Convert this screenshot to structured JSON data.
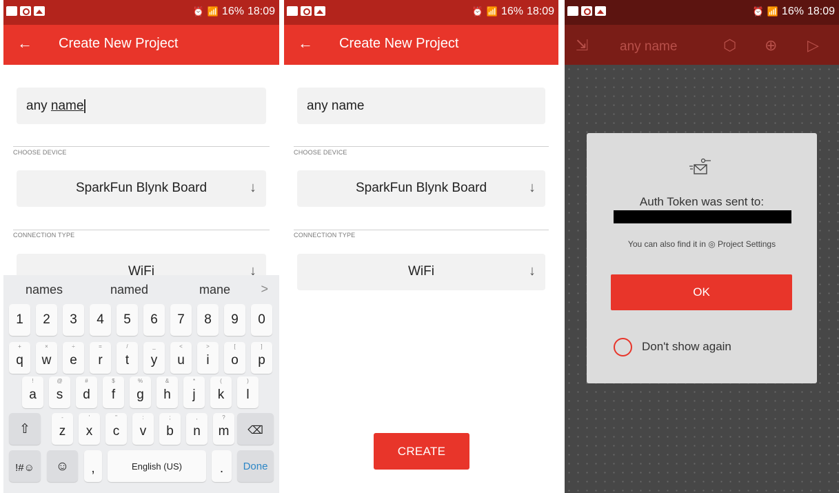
{
  "status_bar": {
    "battery": "16%",
    "time": "18:09"
  },
  "screen1": {
    "title": "Create New Project",
    "project_name_prefix": "any ",
    "project_name_underlined": "name",
    "choose_device_label": "CHOOSE DEVICE",
    "device": "SparkFun Blynk Board",
    "connection_type_label": "CONNECTION TYPE",
    "connection": "WiFi",
    "keyboard": {
      "suggestions": [
        "names",
        "named",
        "mane"
      ],
      "numbers": [
        "1",
        "2",
        "3",
        "4",
        "5",
        "6",
        "7",
        "8",
        "9",
        "0"
      ],
      "row1": [
        "q",
        "w",
        "e",
        "r",
        "t",
        "y",
        "u",
        "i",
        "o",
        "p"
      ],
      "row1_alt": [
        "+",
        "×",
        "÷",
        "=",
        "/",
        "_",
        "<",
        ">",
        "[",
        "]"
      ],
      "row2": [
        "a",
        "s",
        "d",
        "f",
        "g",
        "h",
        "j",
        "k",
        "l"
      ],
      "row2_alt": [
        "!",
        "@",
        "#",
        "$",
        "%",
        "&",
        "*",
        "(",
        ")"
      ],
      "row3": [
        "z",
        "x",
        "c",
        "v",
        "b",
        "n",
        "m"
      ],
      "row3_alt": [
        "-",
        "'",
        "\"",
        ":",
        ";",
        ",",
        "?"
      ],
      "sym_key": "!#☺",
      "comma": ",",
      "space_label": "English (US)",
      "period": ".",
      "done_label": "Done"
    }
  },
  "screen2": {
    "title": "Create New Project",
    "project_name": "any name",
    "choose_device_label": "CHOOSE DEVICE",
    "device": "SparkFun Blynk Board",
    "connection_type_label": "CONNECTION TYPE",
    "connection": "WiFi",
    "create_label": "CREATE"
  },
  "screen3": {
    "project_title": "any name",
    "dialog": {
      "auth_token_text": "Auth Token was sent to:",
      "hint": "You can also find it in ◎ Project Settings",
      "ok_label": "OK",
      "dont_show_label": "Don't show again"
    }
  },
  "colors": {
    "primary": "#e8352a",
    "status": "#b3241c",
    "field_bg": "#f2f2f2"
  }
}
